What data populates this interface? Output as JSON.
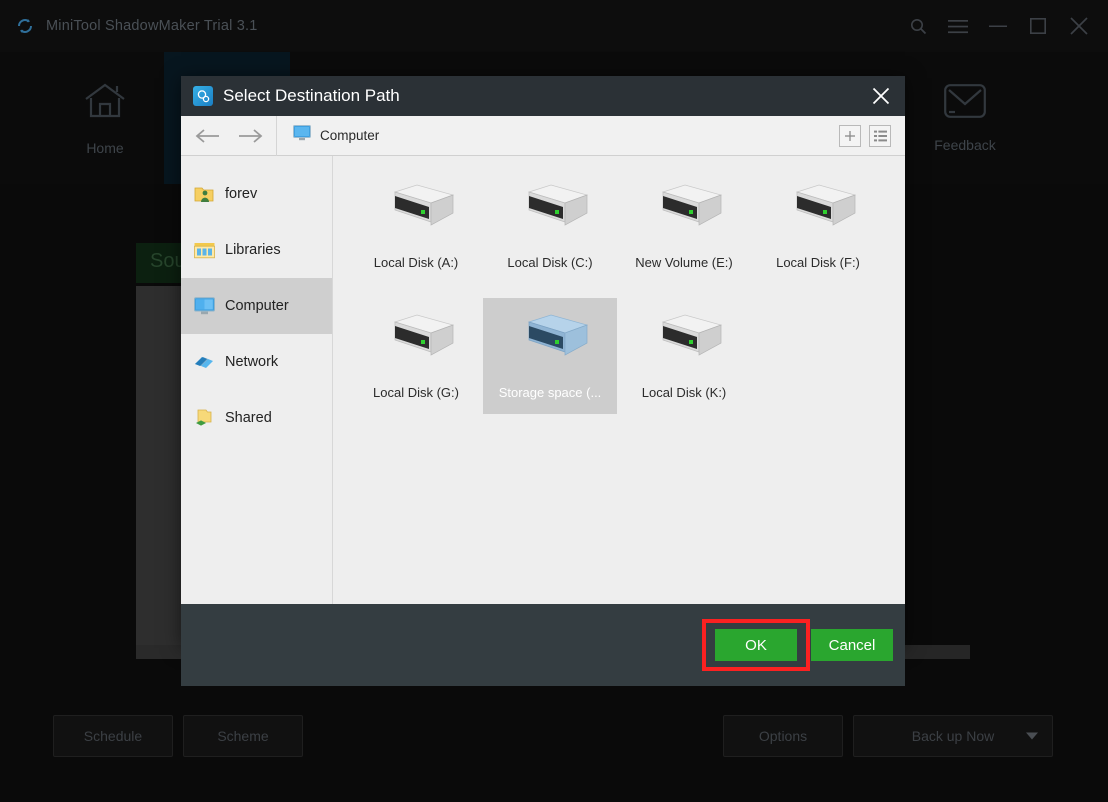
{
  "app": {
    "title": "MiniTool ShadowMaker Trial 3.1",
    "logo_icon": "shadowmaker-logo-icon",
    "window_controls": [
      {
        "name": "search-icon",
        "label": "Search"
      },
      {
        "name": "menu-icon",
        "label": "Menu"
      },
      {
        "name": "minimize-icon",
        "label": "Minimize"
      },
      {
        "name": "maximize-icon",
        "label": "Maximize"
      },
      {
        "name": "close-icon",
        "label": "Close"
      }
    ],
    "nav": [
      {
        "label": "Home",
        "icon": "home-icon"
      },
      {
        "label": "Feedback",
        "icon": "envelope-icon"
      }
    ],
    "source_panel_label": "Source",
    "bottom_buttons": [
      {
        "label": "Schedule",
        "name": "schedule-button"
      },
      {
        "label": "Scheme",
        "name": "scheme-button"
      },
      {
        "label": "Options",
        "name": "options-button"
      },
      {
        "label": "Back up Now",
        "name": "back-up-now-button",
        "has_dropdown": true
      }
    ]
  },
  "dialog": {
    "title": "Select Destination Path",
    "title_icon": "destination-path-icon",
    "close_label": "Close",
    "breadcrumb": {
      "back_label": "Back",
      "forward_label": "Forward",
      "path_icon": "computer-icon",
      "path": "Computer",
      "tools": [
        {
          "name": "new-folder-button",
          "glyph": "+"
        },
        {
          "name": "list-view-button",
          "glyph": "list"
        }
      ]
    },
    "sidebar": [
      {
        "label": "forev",
        "icon": "user-folder-icon",
        "selected": false
      },
      {
        "label": "Libraries",
        "icon": "libraries-icon",
        "selected": false
      },
      {
        "label": "Computer",
        "icon": "computer-icon",
        "selected": true
      },
      {
        "label": "Network",
        "icon": "network-icon",
        "selected": false
      },
      {
        "label": "Shared",
        "icon": "shared-folder-icon",
        "selected": false
      }
    ],
    "drives": [
      {
        "label": "Local Disk (A:)",
        "icon": "hard-drive-icon",
        "selected": false
      },
      {
        "label": "Local Disk (C:)",
        "icon": "hard-drive-icon",
        "selected": false
      },
      {
        "label": "New Volume (E:)",
        "icon": "hard-drive-icon",
        "selected": false
      },
      {
        "label": "Local Disk (F:)",
        "icon": "hard-drive-icon",
        "selected": false
      },
      {
        "label": "Local Disk (G:)",
        "icon": "hard-drive-icon",
        "selected": false
      },
      {
        "label": "Storage space (...",
        "icon": "storage-space-icon",
        "selected": true
      },
      {
        "label": "Local Disk (K:)",
        "icon": "hard-drive-icon",
        "selected": false
      }
    ],
    "buttons": {
      "ok": "OK",
      "cancel": "Cancel"
    }
  },
  "colors": {
    "accent_green": "#2aa62f",
    "highlight_red": "#fb2121",
    "dialog_titlebar": "#2b3136",
    "dialog_footer": "#343d41",
    "selection_gray": "#cdcdcd"
  }
}
